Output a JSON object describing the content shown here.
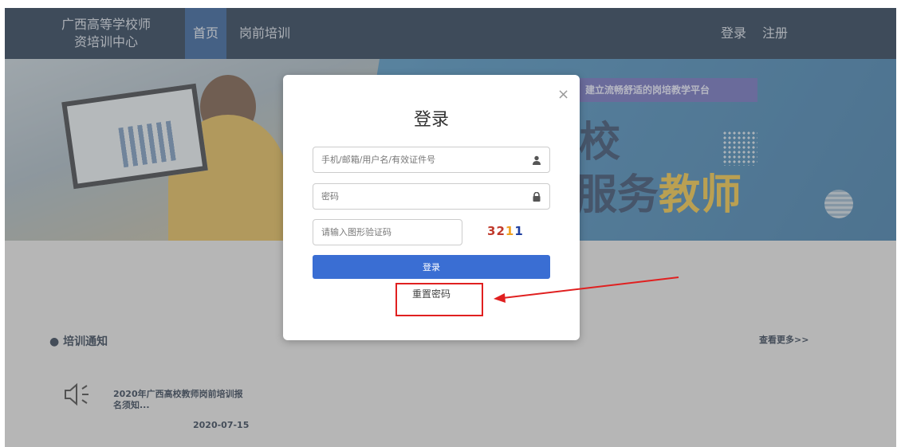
{
  "nav": {
    "brand_line1": "广西高等学校师",
    "brand_line2": "资培训中心",
    "items": [
      {
        "label": "首页",
        "active": true
      },
      {
        "label": "岗前培训",
        "active": false
      }
    ],
    "login_label": "登录",
    "register_label": "注册"
  },
  "banner": {
    "tagline": "建立流畅舒适的岗培教学平台",
    "big_line1": "校",
    "big_line2_a": "服务",
    "big_line2_b": "教师"
  },
  "notices": {
    "title": "培训通知",
    "more_label": "查看更多>>",
    "items": [
      {
        "text": "2020年广西高校教师岗前培训报名须知...",
        "date": "2020-07-15"
      }
    ]
  },
  "modal": {
    "close_label": "×",
    "title": "登录",
    "username_placeholder": "手机/邮箱/用户名/有效证件号",
    "password_placeholder": "密码",
    "captcha_placeholder": "请输入图形验证码",
    "captcha_chars": [
      {
        "ch": "3",
        "color": "#c0392b"
      },
      {
        "ch": "2",
        "color": "#c0392b"
      },
      {
        "ch": "1",
        "color": "#f0a020"
      },
      {
        "ch": "1",
        "color": "#1f3fa0"
      }
    ],
    "login_button": "登录",
    "reset_label": "重置密码"
  },
  "colors": {
    "nav_bg": "#0f2743",
    "nav_active": "#1d4f91",
    "primary_button": "#3a6ed3",
    "annotation": "#e02020"
  }
}
